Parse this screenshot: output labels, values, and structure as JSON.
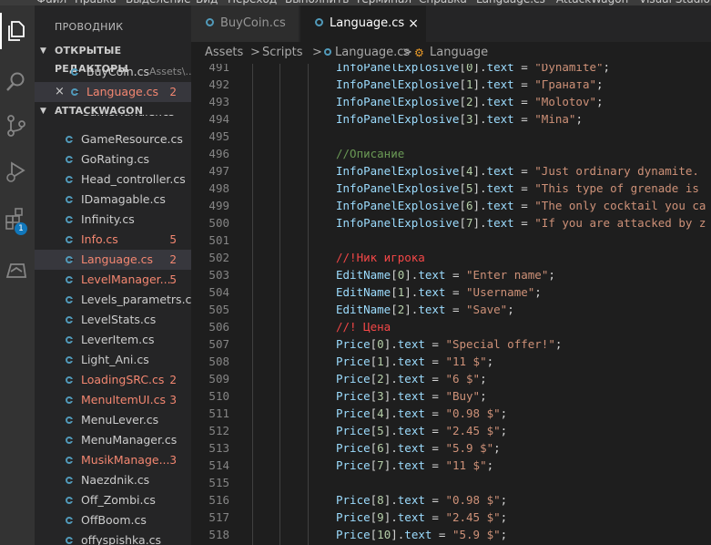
{
  "menubar": [
    "Файл",
    "Правка",
    "Выделение",
    "Вид",
    "Переход",
    "Выполнить",
    "Терминал",
    "Справка",
    "Language.cs - AttackWagon - Visual Studio Code"
  ],
  "activity_bar": [
    {
      "icon": "files-icon",
      "active": true
    },
    {
      "icon": "search-icon",
      "active": false
    },
    {
      "icon": "source-control-icon",
      "active": false
    },
    {
      "icon": "run-debug-icon",
      "active": false
    },
    {
      "icon": "extensions-icon",
      "active": false,
      "badge": "1"
    },
    {
      "icon": "remote-explorer-icon",
      "active": false
    }
  ],
  "sidebar": {
    "title": "ПРОВОДНИК",
    "open_editors_label": "ОТКРЫТЫЕ РЕДАКТОРЫ",
    "open_editors": [
      {
        "name": "BuyCoin.cs",
        "path": "Assets\\...",
        "error": false,
        "badge": ""
      },
      {
        "name": "Language.cs",
        "path": "",
        "error": true,
        "badge": "2",
        "close": "×"
      }
    ],
    "project_label": "ATTACKWAGON",
    "partial_top": "GameHandler.cs",
    "files": [
      {
        "name": "GameResource.cs",
        "error": false,
        "badge": ""
      },
      {
        "name": "GoRating.cs",
        "error": false,
        "badge": ""
      },
      {
        "name": "Head_controller.cs",
        "error": false,
        "badge": ""
      },
      {
        "name": "IDamagable.cs",
        "error": false,
        "badge": ""
      },
      {
        "name": "Infinity.cs",
        "error": false,
        "badge": ""
      },
      {
        "name": "Info.cs",
        "error": true,
        "badge": "5"
      },
      {
        "name": "Language.cs",
        "error": true,
        "badge": "2",
        "selected": true
      },
      {
        "name": "LevelManager...",
        "error": true,
        "badge": "5"
      },
      {
        "name": "Levels_parametrs.cs",
        "error": false,
        "badge": ""
      },
      {
        "name": "LevelStats.cs",
        "error": false,
        "badge": ""
      },
      {
        "name": "LeverItem.cs",
        "error": false,
        "badge": ""
      },
      {
        "name": "Light_Ani.cs",
        "error": false,
        "badge": ""
      },
      {
        "name": "LoadingSRC.cs",
        "error": true,
        "badge": "2"
      },
      {
        "name": "MenuItemUI.cs",
        "error": true,
        "badge": "3"
      },
      {
        "name": "MenuLever.cs",
        "error": false,
        "badge": ""
      },
      {
        "name": "MenuManager.cs",
        "error": false,
        "badge": ""
      },
      {
        "name": "MusikManage...",
        "error": true,
        "badge": "3"
      },
      {
        "name": "Naezdnik.cs",
        "error": false,
        "badge": ""
      },
      {
        "name": "Off_Zombi.cs",
        "error": false,
        "badge": ""
      },
      {
        "name": "OffBoom.cs",
        "error": false,
        "badge": ""
      },
      {
        "name": "offyspishka.cs",
        "error": false,
        "badge": ""
      }
    ]
  },
  "tabs": [
    {
      "label": "BuyCoin.cs",
      "active": false
    },
    {
      "label": "Language.cs",
      "active": true,
      "close": "×"
    }
  ],
  "breadcrumbs": [
    "Assets",
    ">",
    "Scripts",
    ">",
    "Language.cs",
    ">",
    "Language"
  ],
  "editor": {
    "lines": [
      {
        "n": "491",
        "code": [
          [
            "v",
            "InfoPanelExplosive"
          ],
          [
            "p",
            "["
          ],
          [
            "n",
            "0"
          ],
          [
            "p",
            "]."
          ],
          [
            "v",
            "text"
          ],
          [
            "p",
            " = "
          ],
          [
            "s",
            "\"Dynamite\""
          ],
          [
            "p",
            ";"
          ]
        ]
      },
      {
        "n": "492",
        "code": [
          [
            "v",
            "InfoPanelExplosive"
          ],
          [
            "p",
            "["
          ],
          [
            "n",
            "1"
          ],
          [
            "p",
            "]."
          ],
          [
            "v",
            "text"
          ],
          [
            "p",
            " = "
          ],
          [
            "s",
            "\"Граната\""
          ],
          [
            "p",
            ";"
          ]
        ]
      },
      {
        "n": "493",
        "code": [
          [
            "v",
            "InfoPanelExplosive"
          ],
          [
            "p",
            "["
          ],
          [
            "n",
            "2"
          ],
          [
            "p",
            "]."
          ],
          [
            "v",
            "text"
          ],
          [
            "p",
            " = "
          ],
          [
            "s",
            "\"Molotov\""
          ],
          [
            "p",
            ";"
          ]
        ]
      },
      {
        "n": "494",
        "code": [
          [
            "v",
            "InfoPanelExplosive"
          ],
          [
            "p",
            "["
          ],
          [
            "n",
            "3"
          ],
          [
            "p",
            "]."
          ],
          [
            "v",
            "text"
          ],
          [
            "p",
            " = "
          ],
          [
            "s",
            "\"Mina\""
          ],
          [
            "p",
            ";"
          ]
        ]
      },
      {
        "n": "495",
        "code": []
      },
      {
        "n": "496",
        "code": [
          [
            "c",
            "//Описание"
          ]
        ]
      },
      {
        "n": "497",
        "code": [
          [
            "v",
            "InfoPanelExplosive"
          ],
          [
            "p",
            "["
          ],
          [
            "n",
            "4"
          ],
          [
            "p",
            "]."
          ],
          [
            "v",
            "text"
          ],
          [
            "p",
            " = "
          ],
          [
            "s",
            "\"Just ordinary dynamite."
          ]
        ]
      },
      {
        "n": "498",
        "code": [
          [
            "v",
            "InfoPanelExplosive"
          ],
          [
            "p",
            "["
          ],
          [
            "n",
            "5"
          ],
          [
            "p",
            "]."
          ],
          [
            "v",
            "text"
          ],
          [
            "p",
            " = "
          ],
          [
            "s",
            "\"This type of grenade is"
          ]
        ]
      },
      {
        "n": "499",
        "code": [
          [
            "v",
            "InfoPanelExplosive"
          ],
          [
            "p",
            "["
          ],
          [
            "n",
            "6"
          ],
          [
            "p",
            "]."
          ],
          [
            "v",
            "text"
          ],
          [
            "p",
            " = "
          ],
          [
            "s",
            "\"The only cocktail you ca"
          ]
        ]
      },
      {
        "n": "500",
        "code": [
          [
            "v",
            "InfoPanelExplosive"
          ],
          [
            "p",
            "["
          ],
          [
            "n",
            "7"
          ],
          [
            "p",
            "]."
          ],
          [
            "v",
            "text"
          ],
          [
            "p",
            " = "
          ],
          [
            "s",
            "\"If you are attacked by z"
          ]
        ]
      },
      {
        "n": "501",
        "code": []
      },
      {
        "n": "502",
        "code": [
          [
            "r",
            "//!Ник игрока"
          ]
        ]
      },
      {
        "n": "503",
        "code": [
          [
            "v",
            "EditName"
          ],
          [
            "p",
            "["
          ],
          [
            "n",
            "0"
          ],
          [
            "p",
            "]."
          ],
          [
            "v",
            "text"
          ],
          [
            "p",
            " = "
          ],
          [
            "s",
            "\"Enter name\""
          ],
          [
            "p",
            ";"
          ]
        ]
      },
      {
        "n": "504",
        "code": [
          [
            "v",
            "EditName"
          ],
          [
            "p",
            "["
          ],
          [
            "n",
            "1"
          ],
          [
            "p",
            "]."
          ],
          [
            "v",
            "text"
          ],
          [
            "p",
            " = "
          ],
          [
            "s",
            "\"Username\""
          ],
          [
            "p",
            ";"
          ]
        ]
      },
      {
        "n": "505",
        "code": [
          [
            "v",
            "EditName"
          ],
          [
            "p",
            "["
          ],
          [
            "n",
            "2"
          ],
          [
            "p",
            "]."
          ],
          [
            "v",
            "text"
          ],
          [
            "p",
            " = "
          ],
          [
            "s",
            "\"Save\""
          ],
          [
            "p",
            ";"
          ]
        ]
      },
      {
        "n": "506",
        "code": [
          [
            "r",
            "//! Цена"
          ]
        ]
      },
      {
        "n": "507",
        "code": [
          [
            "v",
            "Price"
          ],
          [
            "p",
            "["
          ],
          [
            "n",
            "0"
          ],
          [
            "p",
            "]."
          ],
          [
            "v",
            "text"
          ],
          [
            "p",
            " = "
          ],
          [
            "s",
            "\"Special offer!\""
          ],
          [
            "p",
            ";"
          ]
        ]
      },
      {
        "n": "508",
        "code": [
          [
            "v",
            "Price"
          ],
          [
            "p",
            "["
          ],
          [
            "n",
            "1"
          ],
          [
            "p",
            "]."
          ],
          [
            "v",
            "text"
          ],
          [
            "p",
            " = "
          ],
          [
            "s",
            "\"11 $\""
          ],
          [
            "p",
            ";"
          ]
        ]
      },
      {
        "n": "509",
        "code": [
          [
            "v",
            "Price"
          ],
          [
            "p",
            "["
          ],
          [
            "n",
            "2"
          ],
          [
            "p",
            "]."
          ],
          [
            "v",
            "text"
          ],
          [
            "p",
            " = "
          ],
          [
            "s",
            "\"6 $\""
          ],
          [
            "p",
            ";"
          ]
        ]
      },
      {
        "n": "510",
        "code": [
          [
            "v",
            "Price"
          ],
          [
            "p",
            "["
          ],
          [
            "n",
            "3"
          ],
          [
            "p",
            "]."
          ],
          [
            "v",
            "text"
          ],
          [
            "p",
            " = "
          ],
          [
            "s",
            "\"Buy\""
          ],
          [
            "p",
            ";"
          ]
        ]
      },
      {
        "n": "511",
        "code": [
          [
            "v",
            "Price"
          ],
          [
            "p",
            "["
          ],
          [
            "n",
            "4"
          ],
          [
            "p",
            "]."
          ],
          [
            "v",
            "text"
          ],
          [
            "p",
            " = "
          ],
          [
            "s",
            "\"0.98 $\""
          ],
          [
            "p",
            ";"
          ]
        ]
      },
      {
        "n": "512",
        "code": [
          [
            "v",
            "Price"
          ],
          [
            "p",
            "["
          ],
          [
            "n",
            "5"
          ],
          [
            "p",
            "]."
          ],
          [
            "v",
            "text"
          ],
          [
            "p",
            " = "
          ],
          [
            "s",
            "\"2.45 $\""
          ],
          [
            "p",
            ";"
          ]
        ]
      },
      {
        "n": "513",
        "code": [
          [
            "v",
            "Price"
          ],
          [
            "p",
            "["
          ],
          [
            "n",
            "6"
          ],
          [
            "p",
            "]."
          ],
          [
            "v",
            "text"
          ],
          [
            "p",
            " = "
          ],
          [
            "s",
            "\"5.9 $\""
          ],
          [
            "p",
            ";"
          ]
        ]
      },
      {
        "n": "514",
        "code": [
          [
            "v",
            "Price"
          ],
          [
            "p",
            "["
          ],
          [
            "n",
            "7"
          ],
          [
            "p",
            "]."
          ],
          [
            "v",
            "text"
          ],
          [
            "p",
            " = "
          ],
          [
            "s",
            "\"11 $\""
          ],
          [
            "p",
            ";"
          ]
        ]
      },
      {
        "n": "515",
        "code": []
      },
      {
        "n": "516",
        "code": [
          [
            "v",
            "Price"
          ],
          [
            "p",
            "["
          ],
          [
            "n",
            "8"
          ],
          [
            "p",
            "]."
          ],
          [
            "v",
            "text"
          ],
          [
            "p",
            " = "
          ],
          [
            "s",
            "\"0.98 $\""
          ],
          [
            "p",
            ";"
          ]
        ]
      },
      {
        "n": "517",
        "code": [
          [
            "v",
            "Price"
          ],
          [
            "p",
            "["
          ],
          [
            "n",
            "9"
          ],
          [
            "p",
            "]."
          ],
          [
            "v",
            "text"
          ],
          [
            "p",
            " = "
          ],
          [
            "s",
            "\"2.45 $\""
          ],
          [
            "p",
            ";"
          ]
        ]
      },
      {
        "n": "518",
        "code": [
          [
            "v",
            "Price"
          ],
          [
            "p",
            "["
          ],
          [
            "n",
            "10"
          ],
          [
            "p",
            "]."
          ],
          [
            "v",
            "text"
          ],
          [
            "p",
            " = "
          ],
          [
            "s",
            "\"5.9 $\""
          ],
          [
            "p",
            ";"
          ]
        ]
      }
    ]
  },
  "colors": {
    "activity_bar": "#333333",
    "sidebar": "#252526",
    "editor": "#1e1e1e",
    "error_text": "#f48771",
    "csharp_icon": "#519aba"
  }
}
